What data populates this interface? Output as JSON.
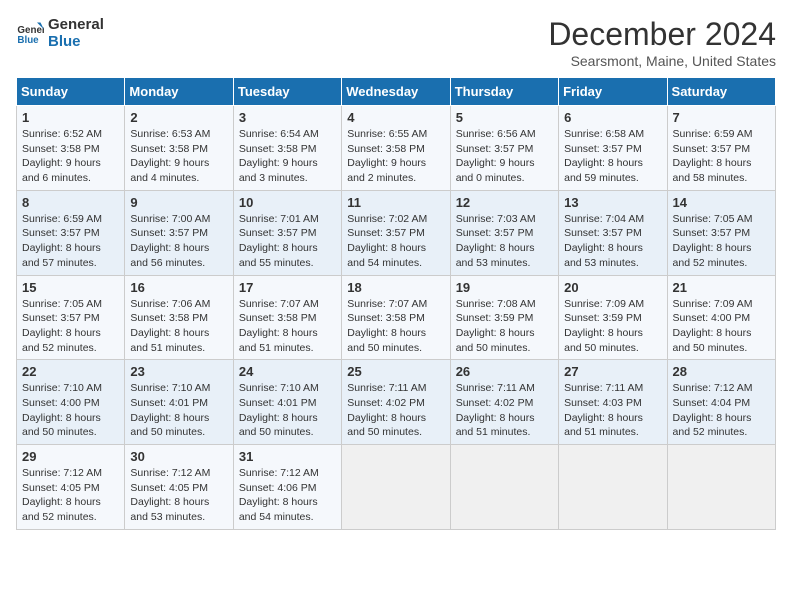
{
  "logo": {
    "text1": "General",
    "text2": "Blue"
  },
  "title": "December 2024",
  "subtitle": "Searsmont, Maine, United States",
  "days_header": [
    "Sunday",
    "Monday",
    "Tuesday",
    "Wednesday",
    "Thursday",
    "Friday",
    "Saturday"
  ],
  "weeks": [
    [
      {
        "day": "1",
        "info": "Sunrise: 6:52 AM\nSunset: 3:58 PM\nDaylight: 9 hours\nand 6 minutes."
      },
      {
        "day": "2",
        "info": "Sunrise: 6:53 AM\nSunset: 3:58 PM\nDaylight: 9 hours\nand 4 minutes."
      },
      {
        "day": "3",
        "info": "Sunrise: 6:54 AM\nSunset: 3:58 PM\nDaylight: 9 hours\nand 3 minutes."
      },
      {
        "day": "4",
        "info": "Sunrise: 6:55 AM\nSunset: 3:58 PM\nDaylight: 9 hours\nand 2 minutes."
      },
      {
        "day": "5",
        "info": "Sunrise: 6:56 AM\nSunset: 3:57 PM\nDaylight: 9 hours\nand 0 minutes."
      },
      {
        "day": "6",
        "info": "Sunrise: 6:58 AM\nSunset: 3:57 PM\nDaylight: 8 hours\nand 59 minutes."
      },
      {
        "day": "7",
        "info": "Sunrise: 6:59 AM\nSunset: 3:57 PM\nDaylight: 8 hours\nand 58 minutes."
      }
    ],
    [
      {
        "day": "8",
        "info": "Sunrise: 6:59 AM\nSunset: 3:57 PM\nDaylight: 8 hours\nand 57 minutes."
      },
      {
        "day": "9",
        "info": "Sunrise: 7:00 AM\nSunset: 3:57 PM\nDaylight: 8 hours\nand 56 minutes."
      },
      {
        "day": "10",
        "info": "Sunrise: 7:01 AM\nSunset: 3:57 PM\nDaylight: 8 hours\nand 55 minutes."
      },
      {
        "day": "11",
        "info": "Sunrise: 7:02 AM\nSunset: 3:57 PM\nDaylight: 8 hours\nand 54 minutes."
      },
      {
        "day": "12",
        "info": "Sunrise: 7:03 AM\nSunset: 3:57 PM\nDaylight: 8 hours\nand 53 minutes."
      },
      {
        "day": "13",
        "info": "Sunrise: 7:04 AM\nSunset: 3:57 PM\nDaylight: 8 hours\nand 53 minutes."
      },
      {
        "day": "14",
        "info": "Sunrise: 7:05 AM\nSunset: 3:57 PM\nDaylight: 8 hours\nand 52 minutes."
      }
    ],
    [
      {
        "day": "15",
        "info": "Sunrise: 7:05 AM\nSunset: 3:57 PM\nDaylight: 8 hours\nand 52 minutes."
      },
      {
        "day": "16",
        "info": "Sunrise: 7:06 AM\nSunset: 3:58 PM\nDaylight: 8 hours\nand 51 minutes."
      },
      {
        "day": "17",
        "info": "Sunrise: 7:07 AM\nSunset: 3:58 PM\nDaylight: 8 hours\nand 51 minutes."
      },
      {
        "day": "18",
        "info": "Sunrise: 7:07 AM\nSunset: 3:58 PM\nDaylight: 8 hours\nand 50 minutes."
      },
      {
        "day": "19",
        "info": "Sunrise: 7:08 AM\nSunset: 3:59 PM\nDaylight: 8 hours\nand 50 minutes."
      },
      {
        "day": "20",
        "info": "Sunrise: 7:09 AM\nSunset: 3:59 PM\nDaylight: 8 hours\nand 50 minutes."
      },
      {
        "day": "21",
        "info": "Sunrise: 7:09 AM\nSunset: 4:00 PM\nDaylight: 8 hours\nand 50 minutes."
      }
    ],
    [
      {
        "day": "22",
        "info": "Sunrise: 7:10 AM\nSunset: 4:00 PM\nDaylight: 8 hours\nand 50 minutes."
      },
      {
        "day": "23",
        "info": "Sunrise: 7:10 AM\nSunset: 4:01 PM\nDaylight: 8 hours\nand 50 minutes."
      },
      {
        "day": "24",
        "info": "Sunrise: 7:10 AM\nSunset: 4:01 PM\nDaylight: 8 hours\nand 50 minutes."
      },
      {
        "day": "25",
        "info": "Sunrise: 7:11 AM\nSunset: 4:02 PM\nDaylight: 8 hours\nand 50 minutes."
      },
      {
        "day": "26",
        "info": "Sunrise: 7:11 AM\nSunset: 4:02 PM\nDaylight: 8 hours\nand 51 minutes."
      },
      {
        "day": "27",
        "info": "Sunrise: 7:11 AM\nSunset: 4:03 PM\nDaylight: 8 hours\nand 51 minutes."
      },
      {
        "day": "28",
        "info": "Sunrise: 7:12 AM\nSunset: 4:04 PM\nDaylight: 8 hours\nand 52 minutes."
      }
    ],
    [
      {
        "day": "29",
        "info": "Sunrise: 7:12 AM\nSunset: 4:05 PM\nDaylight: 8 hours\nand 52 minutes."
      },
      {
        "day": "30",
        "info": "Sunrise: 7:12 AM\nSunset: 4:05 PM\nDaylight: 8 hours\nand 53 minutes."
      },
      {
        "day": "31",
        "info": "Sunrise: 7:12 AM\nSunset: 4:06 PM\nDaylight: 8 hours\nand 54 minutes."
      },
      {
        "day": "",
        "info": ""
      },
      {
        "day": "",
        "info": ""
      },
      {
        "day": "",
        "info": ""
      },
      {
        "day": "",
        "info": ""
      }
    ]
  ]
}
